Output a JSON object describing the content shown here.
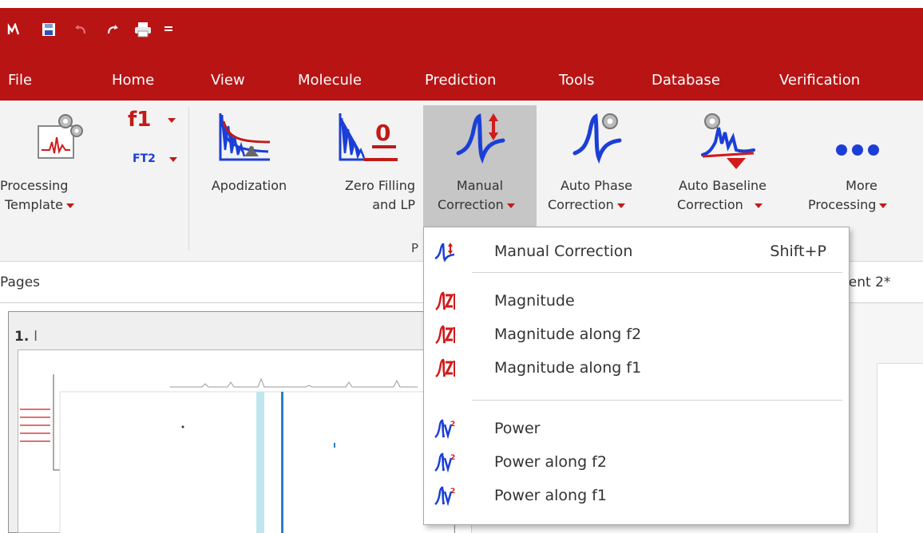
{
  "quick_access": {
    "icons": [
      "app-logo-icon",
      "save-icon",
      "undo-icon",
      "redo-icon",
      "print-icon",
      "customize-icon"
    ]
  },
  "menu_tabs": [
    "File",
    "Home",
    "View",
    "Molecule",
    "Prediction",
    "Tools",
    "Database",
    "Verification"
  ],
  "ribbon": {
    "processing_template": {
      "line1": "Processing",
      "line2": "Template"
    },
    "f1_label": "f1",
    "ft2_label": "FT2",
    "apodization": "Apodization",
    "zero_filling": {
      "line1": "Zero Filling",
      "line2": "and LP"
    },
    "manual_correction": {
      "line1": "Manual",
      "line2": "Correction"
    },
    "auto_phase": {
      "line1": "Auto Phase",
      "line2": "Correction"
    },
    "auto_baseline": {
      "line1": "Auto Baseline",
      "line2": "Correction"
    },
    "more_processing": {
      "line1": "More",
      "line2": "Processing"
    },
    "group_label_partial": "P"
  },
  "pages": {
    "title": "Pages",
    "page_number": "1.",
    "page_name_partial": "l",
    "document_tab_partial": "nent 2*"
  },
  "dropdown": {
    "items": [
      {
        "label": "Manual Correction",
        "shortcut": "Shift+P",
        "icon": "manual-correction-icon"
      },
      {
        "label": "Magnitude",
        "icon": "magnitude-icon"
      },
      {
        "label": "Magnitude along f2",
        "icon": "magnitude-icon"
      },
      {
        "label": "Magnitude along f1",
        "icon": "magnitude-icon"
      },
      {
        "label": "Power",
        "icon": "power-icon"
      },
      {
        "label": "Power along f2",
        "icon": "power-icon"
      },
      {
        "label": "Power along f1",
        "icon": "power-icon"
      }
    ]
  },
  "colors": {
    "brand_red": "#b81414",
    "ribbon_bg": "#f3f3f3",
    "selected_button_bg": "#c6c6c6",
    "icon_blue": "#1b3fd6",
    "icon_red": "#d21a1a"
  }
}
